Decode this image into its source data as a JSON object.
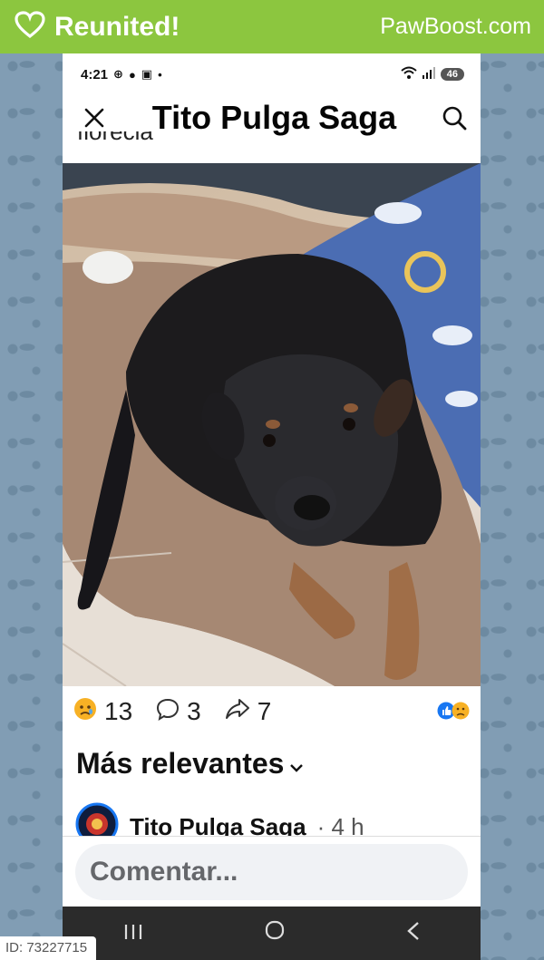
{
  "banner": {
    "title": "Reunited!",
    "brand": "PawBoost.com"
  },
  "status": {
    "time": "4:21",
    "battery": "46"
  },
  "header": {
    "title": "Tito Pulga Saga",
    "cut_text": "florecia"
  },
  "reactions": {
    "count": "13",
    "comments": "3",
    "shares": "7"
  },
  "sort_label": "Más relevantes",
  "comment": {
    "author": "Tito Pulga Saga",
    "time": "· 4 h"
  },
  "composer": {
    "placeholder": "Comentar..."
  },
  "id_label": "ID: 73227715",
  "colors": {
    "banner": "#8cc63f",
    "like_blue": "#1877f2",
    "sad_yellow": "#f7b125"
  }
}
